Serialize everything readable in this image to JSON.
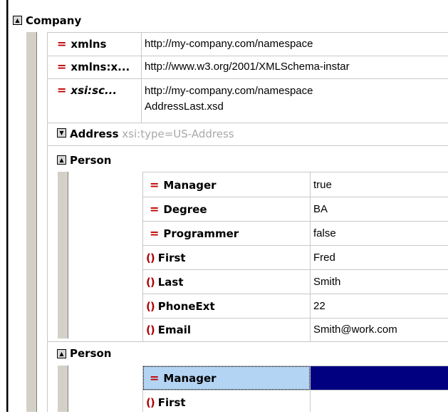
{
  "root": {
    "name": "Company",
    "attributes": [
      {
        "name": "xmlns",
        "value": "http://my-company.com/namespace"
      },
      {
        "name": "xmlns:x...",
        "value": "http://www.w3.org/2001/XMLSchema-instar"
      },
      {
        "name": "xsi:sc...",
        "value_line1": "http://my-company.com/namespace",
        "value_line2": "AddressLast.xsd"
      }
    ],
    "address": {
      "name": "Address",
      "type_hint": "xsi:type=US-Address",
      "persons": [
        {
          "name": "Person",
          "fields": [
            {
              "kind": "attribute",
              "name": "Manager",
              "value": "true"
            },
            {
              "kind": "attribute",
              "name": "Degree",
              "value": "BA"
            },
            {
              "kind": "attribute",
              "name": "Programmer",
              "value": "false"
            },
            {
              "kind": "element",
              "name": "First",
              "value": "Fred"
            },
            {
              "kind": "element",
              "name": "Last",
              "value": "Smith"
            },
            {
              "kind": "element",
              "name": "PhoneExt",
              "value": "22"
            },
            {
              "kind": "element",
              "name": "Email",
              "value": "Smith@work.com"
            }
          ]
        },
        {
          "name": "Person",
          "fields": [
            {
              "kind": "attribute",
              "name": "Manager",
              "value": "",
              "selected": true
            },
            {
              "kind": "element",
              "name": "First",
              "value": ""
            }
          ]
        }
      ]
    }
  },
  "icons": {
    "attribute": "=",
    "element": "()"
  },
  "colors": {
    "selection_cell": "#b4d4f4",
    "selection_value": "#000080",
    "grid": "#c8c8c8",
    "icon": "#c00000"
  }
}
